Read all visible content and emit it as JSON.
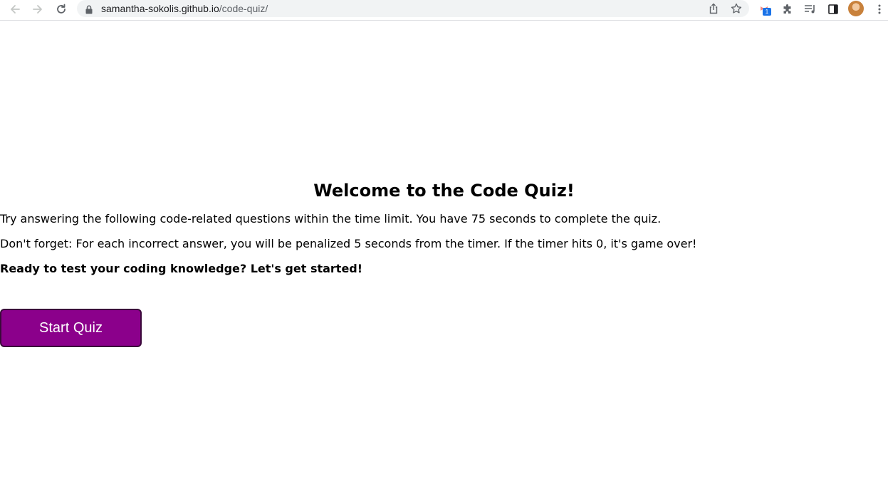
{
  "browser": {
    "url_host": "samantha-sokolis.github.io",
    "url_path": "/code-quiz/",
    "extension_badge": "1",
    "icons": [
      "back-arrow-icon",
      "forward-arrow-icon",
      "reload-icon",
      "lock-icon",
      "share-icon",
      "bookmark-star-icon",
      "extension-icon",
      "puzzle-icon",
      "media-queue-icon",
      "side-panel-icon",
      "more-vert-icon"
    ]
  },
  "quiz": {
    "title": "Welcome to the Code Quiz!",
    "instructions": "Try answering the following code-related questions within the time limit. You have 75 seconds to complete the quiz.",
    "penalty_note": "Don't forget: For each incorrect answer, you will be penalized 5 seconds from the timer. If the timer hits 0, it's game over!",
    "call_to_action": "Ready to test your coding knowledge? Let's get started!",
    "start_button_label": "Start Quiz"
  },
  "colors": {
    "button_background": "#8b008b",
    "button_text": "#ffffff"
  }
}
